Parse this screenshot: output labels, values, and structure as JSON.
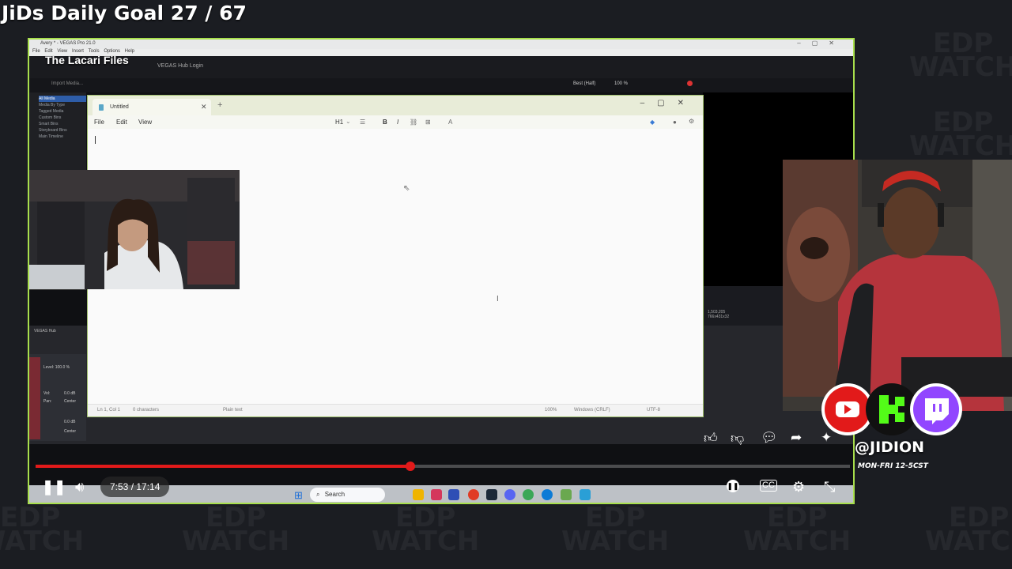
{
  "overlay": {
    "goal_text": "JiDs Daily Goal 27 / 67",
    "watermark": "EDP WATCH",
    "handle": "@JIDION",
    "schedule": "MON-FRI 12-5CST"
  },
  "screen_overlay": {
    "title": "The Lacari Files"
  },
  "vegas": {
    "window_title": "Avery * - VEGAS Pro 21.0",
    "menu": [
      "File",
      "Edit",
      "View",
      "Insert",
      "Tools",
      "Options",
      "Help"
    ],
    "hub_login": "VEGAS Hub Login",
    "import_media": "Import Media...",
    "preview_quality": "Best (Half)",
    "zoom": "100 %",
    "media_tree": [
      "All Media",
      "Media By Type",
      "Tagged Media",
      "Custom Bins",
      "Smart Bins",
      "Storyboard Bins",
      "Main Timeline"
    ],
    "hub_tab": "VEGAS Hub",
    "frame_info": "1,503,205",
    "frame_size": "766x431x32",
    "track_level": "Level: 100.0 %",
    "vol_label": "Vol:",
    "vol_value": "0.0 dB",
    "pan_label": "Pan:",
    "pan_value": "Center",
    "vol2_value": "0.0 dB",
    "pan2_value": "Center"
  },
  "notepad": {
    "tab_title": "Untitled",
    "new_tab": "+",
    "menu": [
      "File",
      "Edit",
      "View"
    ],
    "heading_select": "H1",
    "status": {
      "position": "Ln 1, Col 1",
      "chars": "0 characters",
      "format": "Plain text",
      "zoom": "100%",
      "line_ending": "Windows (CRLF)",
      "encoding": "UTF-8"
    }
  },
  "player": {
    "time": "7:53 / 17:14",
    "progress": 0.46
  },
  "taskbar": {
    "search_placeholder": "Search"
  },
  "colors": {
    "stream_border": "#a8df4c",
    "progress": "#e21a1a",
    "youtube": "#e21a1a",
    "kick": "#53fc18",
    "twitch": "#9146ff"
  }
}
